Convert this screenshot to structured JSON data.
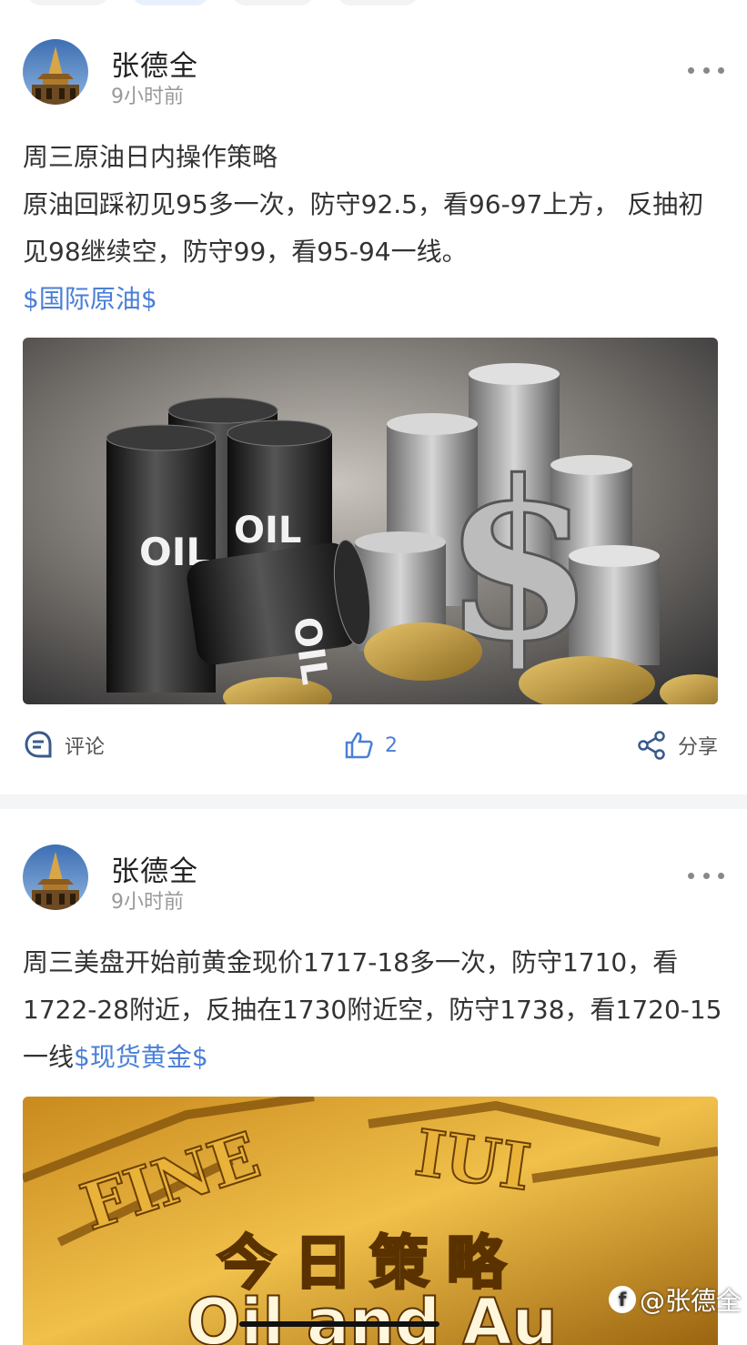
{
  "posts": [
    {
      "author": "张德全",
      "time": "9小时前",
      "title_line": "周三原油日内操作策略",
      "body": "原油回踩初见95多一次，防守92.5，看96-97上方， 反抽初见98继续空，防守99，看95-94一线。",
      "tag": "$国际原油$",
      "image_desc_icon": "oil-barrels-and-dollar-image",
      "actions": {
        "comment_label": "评论",
        "like_count": "2",
        "share_label": "分享"
      }
    },
    {
      "author": "张德全",
      "time": "9小时前",
      "body": "周三美盘开始前黄金现价1717-18多一次，防守1710，看1722-28附近，反抽在1730附近空，防守1738，看1720-15一线",
      "tag": "$现货黄金$",
      "image_text": "今日策略"
    }
  ],
  "watermark": "@张德全",
  "colors": {
    "link": "#4a7fd6",
    "background": "#ffffff",
    "divider": "#f4f5f7"
  }
}
